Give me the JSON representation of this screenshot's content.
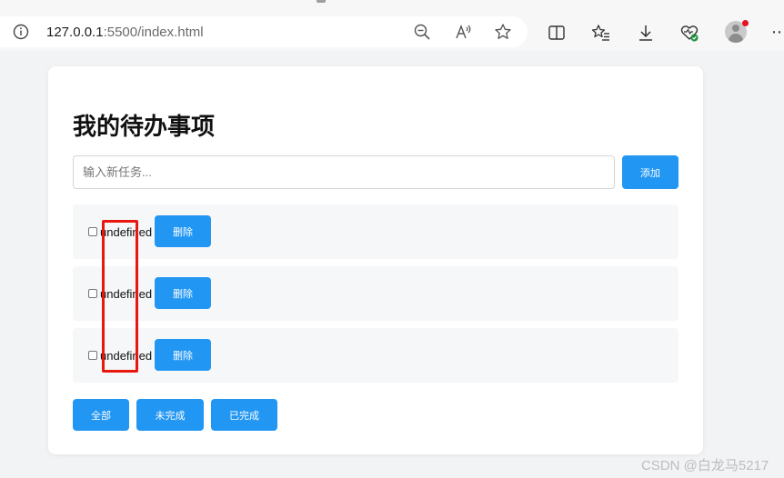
{
  "browser": {
    "url_host": "127.0.0.1",
    "url_rest": ":5500/index.html"
  },
  "app": {
    "title": "我的待办事项",
    "input_placeholder": "输入新任务...",
    "add_label": "添加",
    "todos": [
      {
        "text": "undefined",
        "done": false,
        "delete_label": "删除"
      },
      {
        "text": "undefined",
        "done": false,
        "delete_label": "删除"
      },
      {
        "text": "undefined",
        "done": false,
        "delete_label": "删除"
      }
    ],
    "filters": {
      "all": "全部",
      "active": "未完成",
      "completed": "已完成"
    }
  },
  "watermark": "CSDN @白龙马5217",
  "colors": {
    "accent": "#2196f3",
    "highlight": "#e8170f",
    "item_bg": "#f6f7f9"
  },
  "icons": [
    "info-icon",
    "zoom-out-icon",
    "read-aloud-icon",
    "favorite-star-icon",
    "split-screen-icon",
    "favorites-list-icon",
    "download-icon",
    "browser-essentials-icon",
    "profile-avatar-icon",
    "more-icon"
  ]
}
